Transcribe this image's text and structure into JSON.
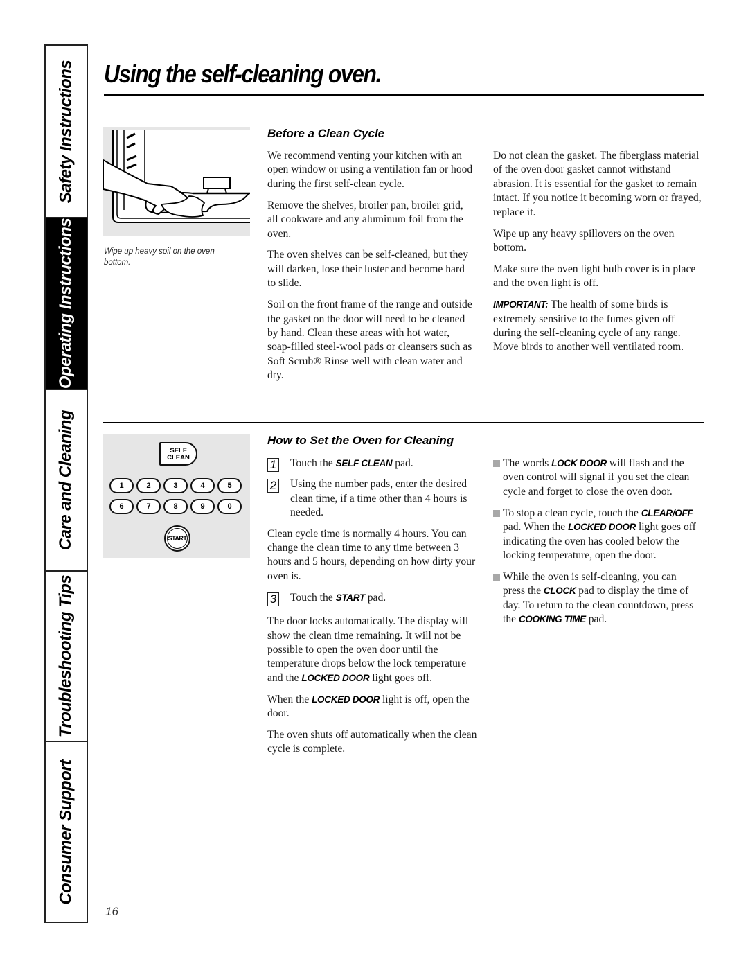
{
  "side_tabs": [
    {
      "label": "Safety Instructions",
      "active": false
    },
    {
      "label": "Operating Instructions",
      "active": true
    },
    {
      "label": "Care and Cleaning",
      "active": false
    },
    {
      "label": "Troubleshooting Tips",
      "active": false
    },
    {
      "label": "Consumer Support",
      "active": false
    }
  ],
  "header": {
    "title": "Using the self-cleaning oven."
  },
  "before_section": {
    "heading": "Before a Clean Cycle",
    "illustration": "hand-wiping-oven-bottom",
    "caption": "Wipe up heavy soil on the oven bottom.",
    "col1": [
      "We recommend venting your kitchen with an open window or using a ventilation fan or hood during the first self-clean cycle.",
      "Remove the shelves, broiler pan, broiler grid, all cookware and any aluminum foil from the oven.",
      "The oven shelves can be self-cleaned, but they will darken, lose their luster and become hard to slide.",
      "Soil on the front frame of the range and outside the gasket on the door will need to be cleaned by hand. Clean these areas with hot water, soap-filled steel-wool pads or cleansers such as Soft Scrub® Rinse well with clean water and dry."
    ],
    "col2": [
      "Do not clean the gasket. The fiberglass material of the oven door gasket cannot withstand abrasion. It is essential for the gasket to remain intact. If you notice it becoming worn or frayed, replace it.",
      "Wipe up any heavy spillovers on the oven bottom.",
      "Make sure the oven light bulb cover is in place and the oven light is off."
    ],
    "important_label": "IMPORTANT:",
    "important_text": " The health of some birds is extremely sensitive to the fumes given off during the self-cleaning cycle of any range. Move birds to another well ventilated room."
  },
  "howto_section": {
    "heading": "How to Set the Oven for Cleaning",
    "keypad": {
      "self_clean_line1": "SELF",
      "self_clean_line2": "CLEAN",
      "row1": [
        "1",
        "2",
        "3",
        "4",
        "5"
      ],
      "row2": [
        "6",
        "7",
        "8",
        "9",
        "0"
      ],
      "start": "START"
    },
    "steps": [
      {
        "num": "1",
        "pre": "Touch the ",
        "kw": "SELF CLEAN",
        "post": " pad."
      },
      {
        "num": "2",
        "text": "Using the number pads, enter the desired clean time, if a time other than 4 hours is needed."
      },
      {
        "num": "3",
        "pre": "Touch the ",
        "kw": "START",
        "post": " pad."
      }
    ],
    "clean_time_note": "Clean cycle time is normally 4 hours. You can change the clean time to any time between 3 hours and 5 hours, depending on how dirty your oven is.",
    "door_lock": {
      "pre": "The door locks automatically. The display will show the clean time remaining. It will not be possible to open the oven door until the temperature drops below the lock temperature and the ",
      "kw": "LOCKED DOOR",
      "post": " light goes off."
    },
    "when_locked": {
      "pre": "When the ",
      "kw": "LOCKED DOOR",
      "post": " light is off, open the door."
    },
    "shuts_off": "The oven shuts off automatically when the clean cycle is complete.",
    "bullets": [
      {
        "pre": "The words ",
        "kw1": "LOCK DOOR",
        "post": " will flash and the oven control will signal if you set the clean cycle and forget to close the oven door."
      },
      {
        "pre": "To stop a clean cycle, touch the ",
        "kw1": "CLEAR/OFF",
        "mid": " pad. When the ",
        "kw2": "LOCKED DOOR",
        "post": " light goes off indicating the oven has cooled below the locking temperature, open the door."
      },
      {
        "pre": "While the oven is self-cleaning, you can press the ",
        "kw1": "CLOCK",
        "mid": " pad to display the time of day. To return to the clean countdown, press the ",
        "kw2": "COOKING TIME",
        "post": " pad."
      }
    ]
  },
  "footer": {
    "page_number": "16"
  }
}
